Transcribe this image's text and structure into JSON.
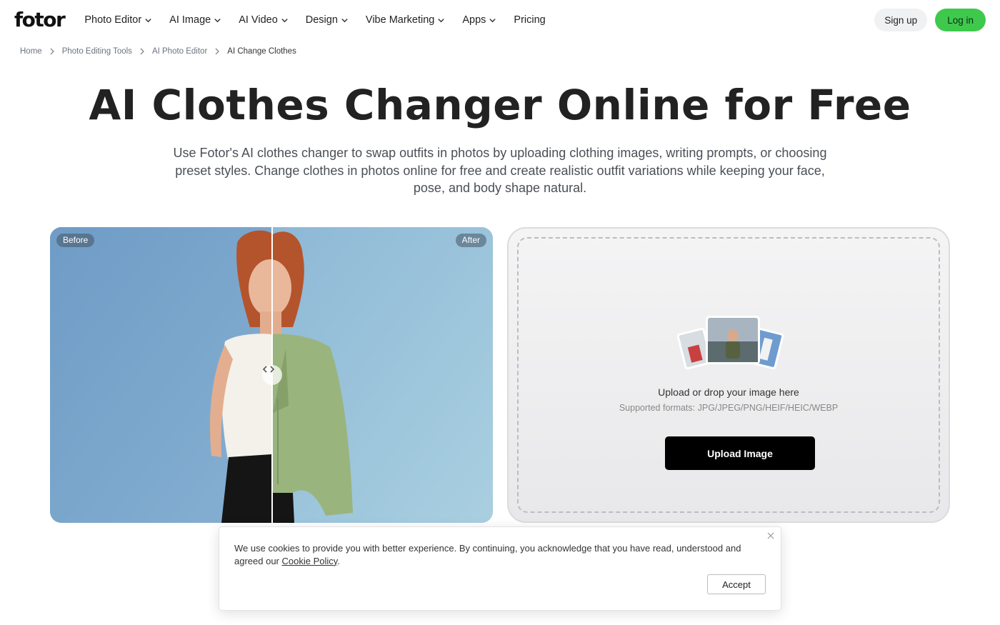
{
  "header": {
    "logo": "fotor",
    "nav": [
      {
        "label": "Photo Editor",
        "dropdown": true
      },
      {
        "label": "AI Image",
        "dropdown": true
      },
      {
        "label": "AI Video",
        "dropdown": true
      },
      {
        "label": "Design",
        "dropdown": true
      },
      {
        "label": "Vibe Marketing",
        "dropdown": true
      },
      {
        "label": "Apps",
        "dropdown": true
      },
      {
        "label": "Pricing",
        "dropdown": false
      }
    ],
    "signup_label": "Sign up",
    "login_label": "Log in",
    "accent_color": "#3ec94c"
  },
  "breadcrumb": [
    "Home",
    "Photo Editing Tools",
    "AI Photo Editor",
    "AI Change Clothes"
  ],
  "hero": {
    "title": "AI Clothes Changer Online for Free",
    "subtitle": "Use Fotor's AI clothes changer to swap outfits in photos by uploading clothing images, writing prompts, or choosing preset styles. Change clothes in photos online for free and create realistic outfit variations while keeping your face, pose, and body shape natural."
  },
  "compare": {
    "before_label": "Before",
    "after_label": "After"
  },
  "upload": {
    "title": "Upload or drop your image here",
    "formats": "Supported formats: JPG/JPEG/PNG/HEIF/HEIC/WEBP",
    "button_label": "Upload Image"
  },
  "cookie": {
    "text": "We use cookies to provide you with better experience. By continuing, you acknowledge that you have read, understood and agreed our ",
    "link_label": "Cookie Policy",
    "period": ".",
    "accept_label": "Accept"
  }
}
